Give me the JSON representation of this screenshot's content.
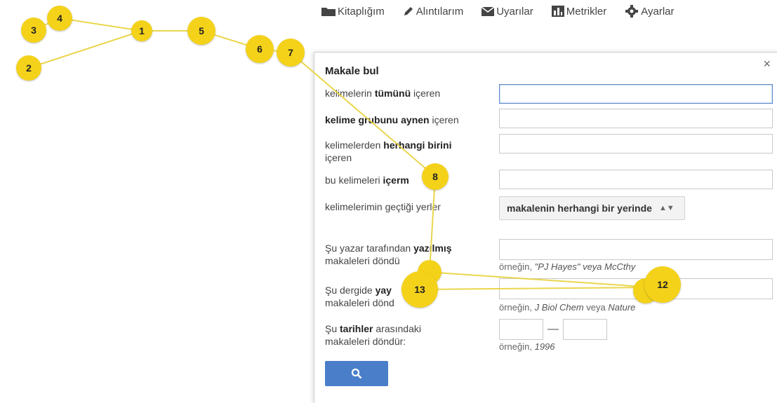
{
  "nav": {
    "items": [
      {
        "label": "Kitaplığım",
        "icon": "folder-icon"
      },
      {
        "label": "Alıntılarım",
        "icon": "pencil-icon"
      },
      {
        "label": "Uyarılar",
        "icon": "envelope-icon"
      },
      {
        "label": "Metrikler",
        "icon": "bar-chart-icon"
      },
      {
        "label": "Ayarlar",
        "icon": "gear-icon"
      }
    ]
  },
  "dialog": {
    "title": "Makale bul",
    "close": "×",
    "rows": {
      "all_pre": "kelimelerin ",
      "all_bold": "tümünü",
      "all_post": " içeren",
      "exact_bold": "kelime grubunu aynen",
      "exact_post": " içeren",
      "any_pre": "kelimelerden ",
      "any_bold": "herhangi birini",
      "any_post": " içeren",
      "none_pre": "bu kelimeleri ",
      "none_bold": "içerm",
      "where": "kelimelerimin geçtiği yerler",
      "author_pre": "Şu yazar tarafından ",
      "author_bold": "yazılmış",
      "author_post": "makaleleri döndü",
      "journal_pre": "Şu dergide ",
      "journal_bold": "yay",
      "journal_bold2": "ış",
      "journal_post": "makaleleri dönd",
      "date_pre": "Şu ",
      "date_bold": "tarihler",
      "date_post": " arasındaki",
      "date_post2": "makaleleri döndür:"
    },
    "select_value": "makalenin herhangi bir yerinde",
    "hints": {
      "author_pre": "örneğin, ",
      "author_it": "\"PJ Hayes\" veya McC",
      "author_tail": "thy",
      "journal_pre": "örneğin, ",
      "journal_it": "J Biol Chem",
      "journal_mid": " veya ",
      "journal_tail": "Nature",
      "date_pre": "örneğin, ",
      "date_it": "1996"
    },
    "date_sep": "—",
    "search_icon": "search-icon"
  },
  "markers": [
    "1",
    "2",
    "3",
    "4",
    "5",
    "6",
    "7",
    "8",
    "12",
    "13",
    "13"
  ],
  "colors": {
    "marker": "#f4d21a",
    "line": "#e8d23a",
    "button": "#4a7ec9"
  }
}
